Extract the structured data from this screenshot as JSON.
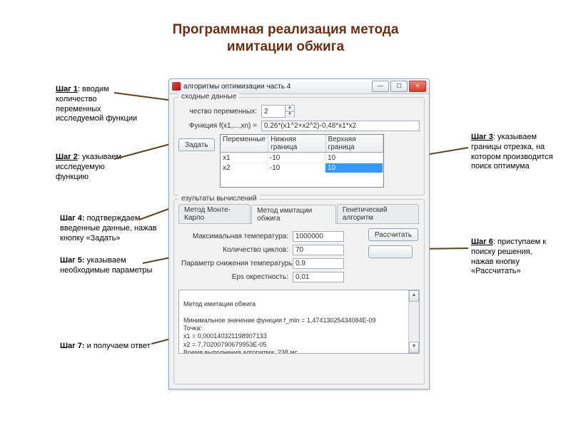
{
  "slide": {
    "title_line1": "Программная реализация метода",
    "title_line2": "имитации обжига"
  },
  "annotations": {
    "step1_b": "Шаг 1",
    "step1": ": вводим количество переменных исследуемой функции",
    "step2_b": "Шаг 2",
    "step2": ": указываем исследуемую функцию",
    "step3_b": "Шаг 3",
    "step3": ": указываем границы отрезка, на котором производится поиск оптимума",
    "step4_b": "Шаг 4:",
    "step4": " подтверждаем введенные данные, нажав кнопку «Задать»",
    "step5_b": "Шаг 5:",
    "step5": "  указываем необходимые параметры",
    "step6_b": "Шаг 6",
    "step6": ": приступаем к поиску решения, нажав кнопку «Рассчитать»",
    "step7_b": "Шаг 7:",
    "step7": "  и получаем ответ"
  },
  "window": {
    "title": "алгоритмы оптимизации часть 4",
    "group_input_title": "сходные данные",
    "vars_label": "чество переменных:",
    "vars_value": "2",
    "func_label": "Функция f(x1,...,xn) =",
    "func_value": "0,26*(x1^2+x2^2)-0,48*x1*x2",
    "grid_headers": [
      "Переменные",
      "Нижняя граница",
      "Верхняя граница"
    ],
    "grid_rows": [
      {
        "var": "x1",
        "low": "-10",
        "high": "10"
      },
      {
        "var": "x2",
        "low": "-10",
        "high": "10"
      }
    ],
    "set_btn": "Задать",
    "group_results_title": "езультаты вычислений",
    "tabs": [
      "Метод Монте-Карло",
      "Метод имитации обжига",
      "Генетический алгоритм"
    ],
    "active_tab": 1,
    "params": {
      "max_temp_lbl": "Максимальная температура:",
      "max_temp_val": "1000000",
      "cycles_lbl": "Количество циклов:",
      "cycles_val": "70",
      "decay_lbl": "Параметр снижения температуры:",
      "decay_val": "0.9",
      "eps_lbl": "Eps окрестность:",
      "eps_val": "0,01"
    },
    "calc_btn": "Рассчитать",
    "output": "Метод имитации обжига\n\nМинимальное значение функции f_min = 1,47413025434084E-09\nТочка:\nx1 = 0,000140321198907133\nx2 = 7,70200790679953E-05\nВремя выполнения алгоритма: 238 мс"
  }
}
